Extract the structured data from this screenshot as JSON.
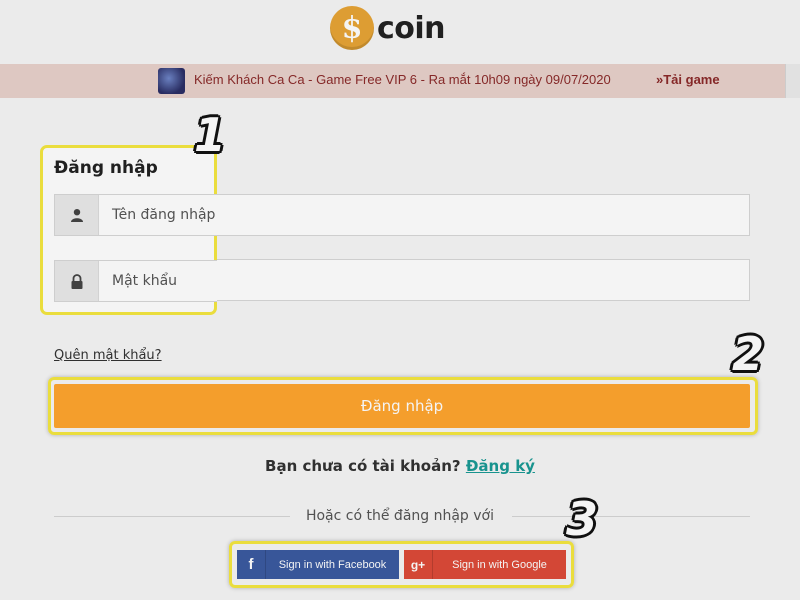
{
  "header": {
    "logo_symbol": "$",
    "logo_text": "coin"
  },
  "announcement": {
    "text": "Kiếm Khách Ca Ca - Game Free VIP 6 - Ra mắt 10h09 ngày 09/07/2020",
    "link": "»Tải game"
  },
  "login": {
    "title": "Đăng nhập",
    "username_placeholder": "Tên đăng nhập",
    "password_placeholder": "Mật khẩu",
    "forgot_label": "Quên mật khẩu?",
    "submit_label": "Đăng nhập",
    "no_account_text": "Bạn chưa có tài khoản?",
    "register_label": "Đăng ký",
    "or_text": "Hoặc có thể đăng nhập với"
  },
  "social": {
    "facebook_icon": "f",
    "facebook_label": "Sign in with Facebook",
    "google_icon": "g+",
    "google_label": "Sign in with Google"
  },
  "steps": [
    "1",
    "2",
    "3"
  ],
  "colors": {
    "brand_orange": "#ffa62f",
    "link_teal": "#1a9a95",
    "highlight_yellow": "#f5e740",
    "facebook_blue": "#3b5aa0",
    "google_red": "#dd4b39"
  }
}
